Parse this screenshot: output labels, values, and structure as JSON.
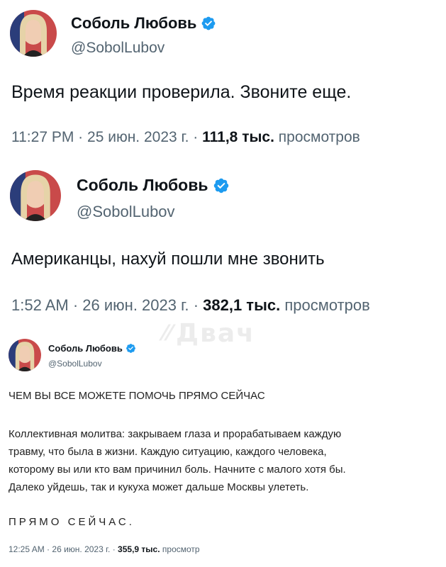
{
  "tweets": [
    {
      "author_name": "Соболь Любовь",
      "author_handle": "@SobolLubov",
      "verified_icon": "verified-badge-icon",
      "text": "Время реакции проверила. Звоните еще.",
      "time": "11:27 PM",
      "date": "25 июн. 2023 г.",
      "views_count": "111,8 тыс.",
      "views_label": "просмотров"
    },
    {
      "author_name": "Соболь Любовь",
      "author_handle": "@SobolLubov",
      "verified_icon": "verified-badge-icon",
      "text": "Американцы, нахуй пошли мне звонить",
      "time": "1:52 AM",
      "date": "26 июн. 2023 г.",
      "views_count": "382,1 тыс.",
      "views_label": "просмотров"
    },
    {
      "author_name": "Соболь Любовь",
      "author_handle": "@SobolLubov",
      "verified_icon": "verified-badge-icon",
      "heading": "ЧЕМ ВЫ ВСЕ МОЖЕТЕ ПОМОЧЬ ПРЯМО СЕЙЧАС",
      "paragraph_lines": [
        "Коллективная молитва: закрываем глаза и прорабатываем каждую",
        "травму, что была в жизни. Каждую ситуацию, каждого человека,",
        "которому вы или кто вам причинил боль. Начните с малого хотя бы.",
        "Далеко уйдешь, так и кукуха может дальше Москвы улететь."
      ],
      "closing": "ПРЯМО СЕЙЧАС.",
      "time": "12:25 AM",
      "date": "26 июн. 2023 г.",
      "views_count": "355,9 тыс.",
      "views_label": "просмотр"
    }
  ],
  "meta_separator": "·",
  "watermark": "Двач",
  "colors": {
    "verified_blue": "#1d9bf0",
    "secondary_text": "#536471",
    "primary_text": "#0f1419"
  }
}
